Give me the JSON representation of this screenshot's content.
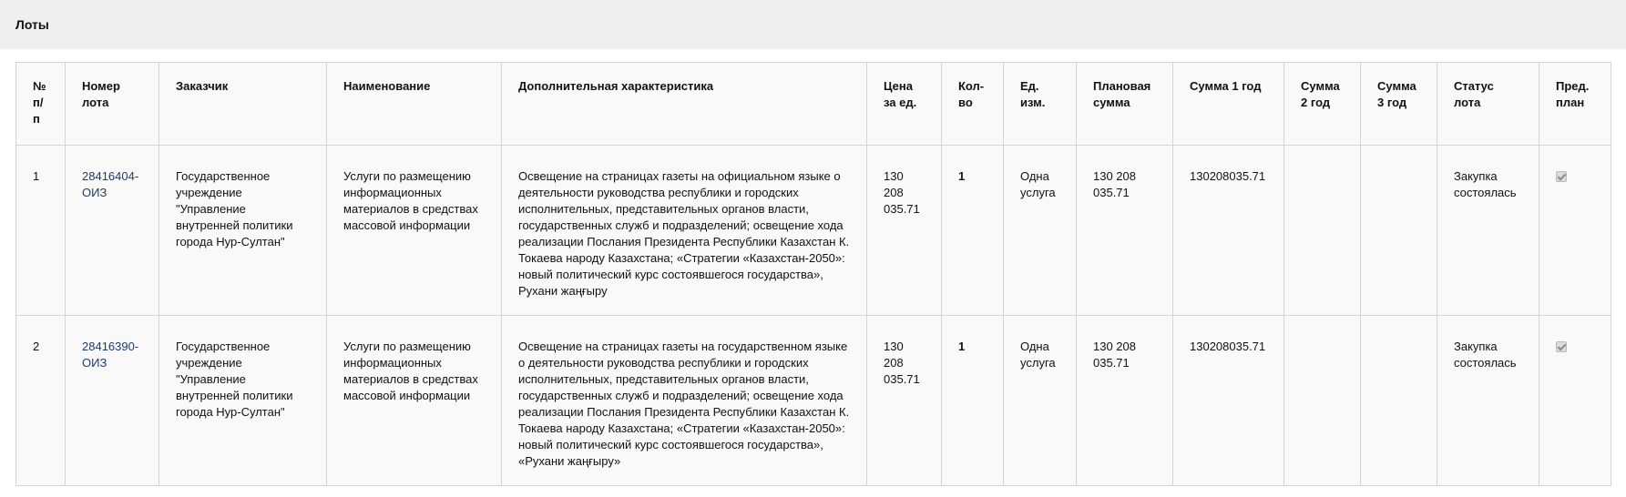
{
  "panel": {
    "title": "Лоты"
  },
  "table": {
    "columns": [
      "№ п/п",
      "Номер лота",
      "Заказчик",
      "Наименование",
      "Дополнительная характеристика",
      "Цена за ед.",
      "Кол-во",
      "Ед. изм.",
      "Плановая сумма",
      "Сумма 1 год",
      "Сумма 2 год",
      "Сумма 3 год",
      "Статус лота",
      "Пред. план"
    ],
    "rows": [
      {
        "num": "1",
        "lot": "28416404-ОИЗ",
        "customer": "Государственное учреждение \"Управление внутренней политики города Нур-Султан\"",
        "name": "Услуги по размещению информационных материалов в средствах массовой информации",
        "extra": "Освещение на страницах газеты на официальном языке о деятельности руководства республики и городских исполнительных, представительных органов власти, государственных служб и подразделений; освещение хода реализации Послания Президента Республики Казахстан К. Токаева народу Казахстана; «Стратегии «Казахстан-2050»: новый политический курс состоявшегося государства», Рухани жаңғыру",
        "price": "130 208 035.71",
        "qty": "1",
        "unit": "Одна услуга",
        "planned": "130 208 035.71",
        "sum1": "130208035.71",
        "sum2": "",
        "sum3": "",
        "status": "Закупка состоялась",
        "preplan": true
      },
      {
        "num": "2",
        "lot": "28416390-ОИЗ",
        "customer": "Государственное учреждение \"Управление внутренней политики города Нур-Султан\"",
        "name": "Услуги по размещению информационных материалов в средствах массовой информации",
        "extra": "Освещение на страницах газеты на государственном языке о деятельности руководства республики и городских исполнительных, представительных органов власти, государственных служб и подразделений; освещение хода реализации Послания Президента Республики Казахстан К. Токаева народу Казахстана; «Стратегии «Казахстан-2050»: новый политический курс состоявшегося государства», «Рухани жаңғыру»",
        "price": "130 208 035.71",
        "qty": "1",
        "unit": "Одна услуга",
        "planned": "130 208 035.71",
        "sum1": "130208035.71",
        "sum2": "",
        "sum3": "",
        "status": "Закупка состоялась",
        "preplan": true
      }
    ]
  }
}
